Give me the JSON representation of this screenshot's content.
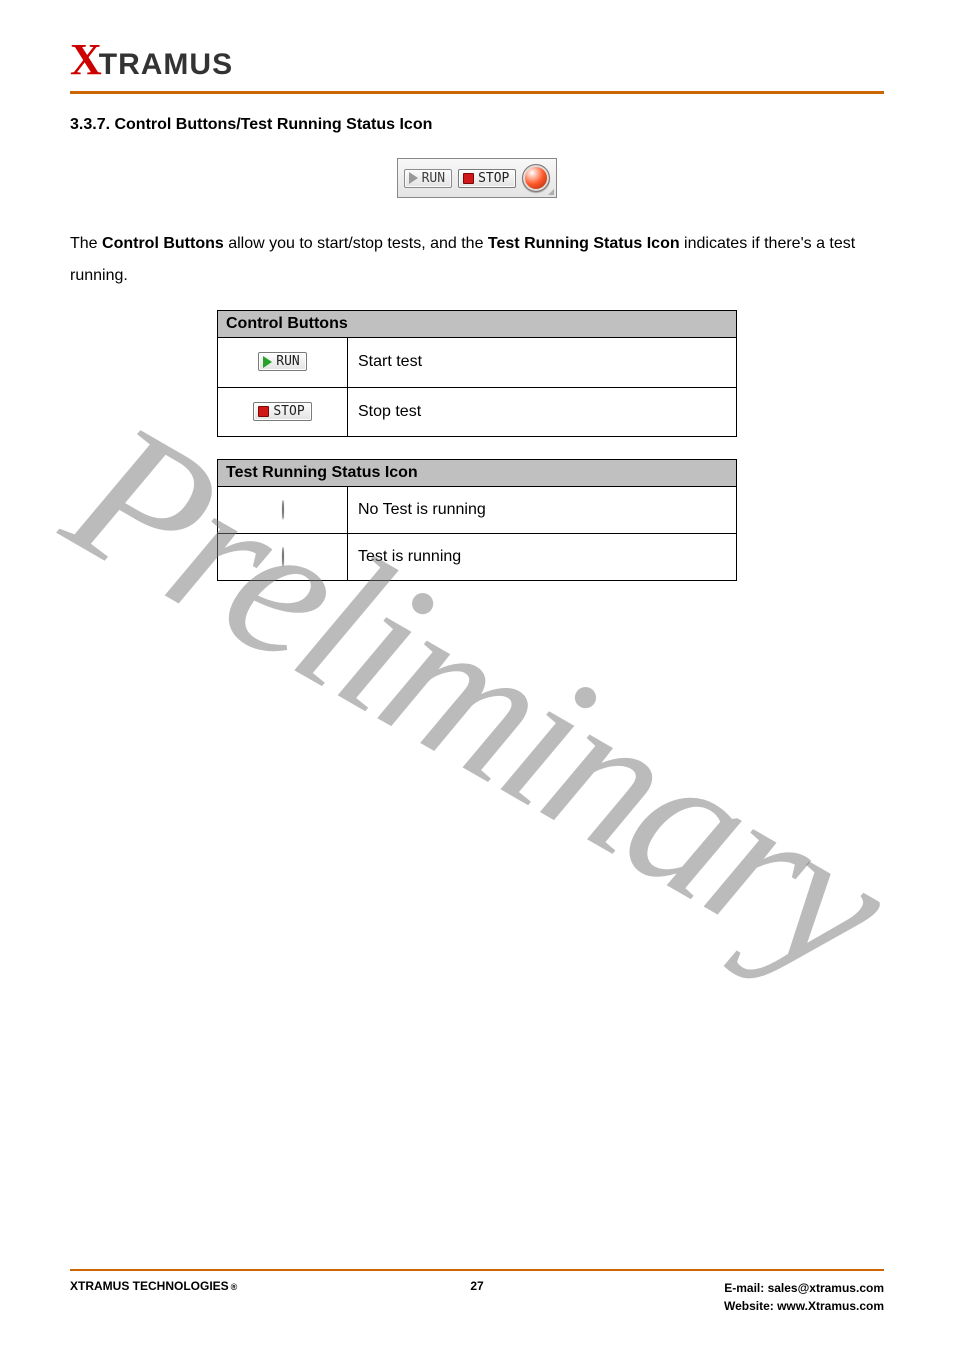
{
  "brand": {
    "x": "X",
    "rest": "TRAMUS"
  },
  "section_title": "3.3.7. Control Buttons/Test Running Status Icon",
  "toolbar": {
    "run_label": "RUN",
    "stop_label": "STOP"
  },
  "paragraph": {
    "pre": "The ",
    "b1": "Control Buttons",
    "mid": " allow you to start/stop tests, and the ",
    "b2": "Test Running Status Icon",
    "post": " indicates if there's a test running."
  },
  "table1": {
    "header": "Control Buttons",
    "rows": [
      {
        "btn": "RUN",
        "desc": "Start test"
      },
      {
        "btn": "STOP",
        "desc": "Stop test"
      }
    ]
  },
  "table2": {
    "header": "Test Running Status Icon",
    "rows": [
      {
        "orb": "red",
        "desc": "No Test is running"
      },
      {
        "orb": "green",
        "desc": "Test is running"
      }
    ]
  },
  "watermark": "Preliminary",
  "footer": {
    "company": "XTRAMUS TECHNOLOGIES",
    "reg": "®",
    "page": "27",
    "email_label": "E-mail: ",
    "email": "sales@xtramus.com",
    "site_label": "Website:  ",
    "site": "www.Xtramus.com"
  }
}
